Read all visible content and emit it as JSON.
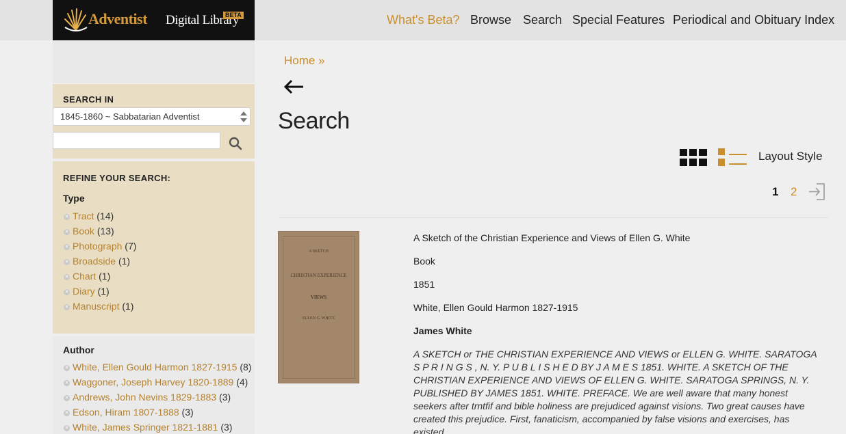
{
  "header": {
    "brand_primary": "Adventist",
    "brand_secondary": "Digital Library",
    "beta_badge": "BETA",
    "nav": [
      "What's Beta?",
      "Browse",
      "Search",
      "Special Features",
      "Periodical and Obituary Index"
    ]
  },
  "sidebar": {
    "search_in_label": "SEARCH IN",
    "search_in_value": "1845-1860 ~ Sabbatarian Adventist",
    "query_value": "",
    "refine_label": "REFINE YOUR SEARCH:",
    "type_title": "Type",
    "type_items": [
      {
        "label": "Tract",
        "count": "(14)"
      },
      {
        "label": "Book",
        "count": "(13)"
      },
      {
        "label": "Photograph",
        "count": "(7)"
      },
      {
        "label": "Broadside",
        "count": "(1)"
      },
      {
        "label": "Chart",
        "count": "(1)"
      },
      {
        "label": "Diary",
        "count": "(1)"
      },
      {
        "label": "Manuscript",
        "count": "(1)"
      }
    ],
    "author_title": "Author",
    "author_items": [
      {
        "label": "White, Ellen Gould Harmon 1827-1915",
        "count": "(8)"
      },
      {
        "label": "Waggoner, Joseph Harvey 1820-1889",
        "count": "(4)"
      },
      {
        "label": "Andrews, John Nevins 1829-1883",
        "count": "(3)"
      },
      {
        "label": "Edson, Hiram 1807-1888",
        "count": "(3)"
      },
      {
        "label": "White, James Springer 1821-1881",
        "count": "(3)"
      }
    ]
  },
  "main": {
    "breadcrumb": "Home »",
    "title": "Search",
    "layout_label": "Layout Style",
    "page_current": "1",
    "page_next": "2"
  },
  "result": {
    "cover": {
      "line1": "A SKETCH",
      "line2": "CHRISTIAN EXPERIENCE",
      "line3": "VIEWS",
      "line4": "ELLEN G. WHITE"
    },
    "title": "A Sketch of the Christian Experience and Views of Ellen G. White",
    "type": "Book",
    "year": "1851",
    "author": "White, Ellen Gould Harmon 1827-1915",
    "publisher": "James White",
    "snippet": "A SKETCH or THE CHRISTIAN EXPERIENCE AND VIEWS or ELLEN G. WHITE. SARATOGA S P R I N G S , N. Y. P U B L I S H E D BY J A M E S 1851. WHITE. A SKETCH OF THE CHRISTIAN EXPERIENCE AND VIEWS OF ELLEN G. WHITE. SARATOGA SPRINGS, N. Y. PUBLISHED BY JAMES 1851. WHITE. PREFACE. We are well aware that many honest seekers after trntfif and bible holiness are prejudiced against visions. Two great causes have created this prejudice. First, fanaticism, accompanied by false visions and exercises, has existed"
  },
  "colors": {
    "accent": "#c98f2f",
    "sidebar_panel": "#e9dec3",
    "header_bg": "#e3e3e3",
    "logo_bg": "#111111"
  }
}
